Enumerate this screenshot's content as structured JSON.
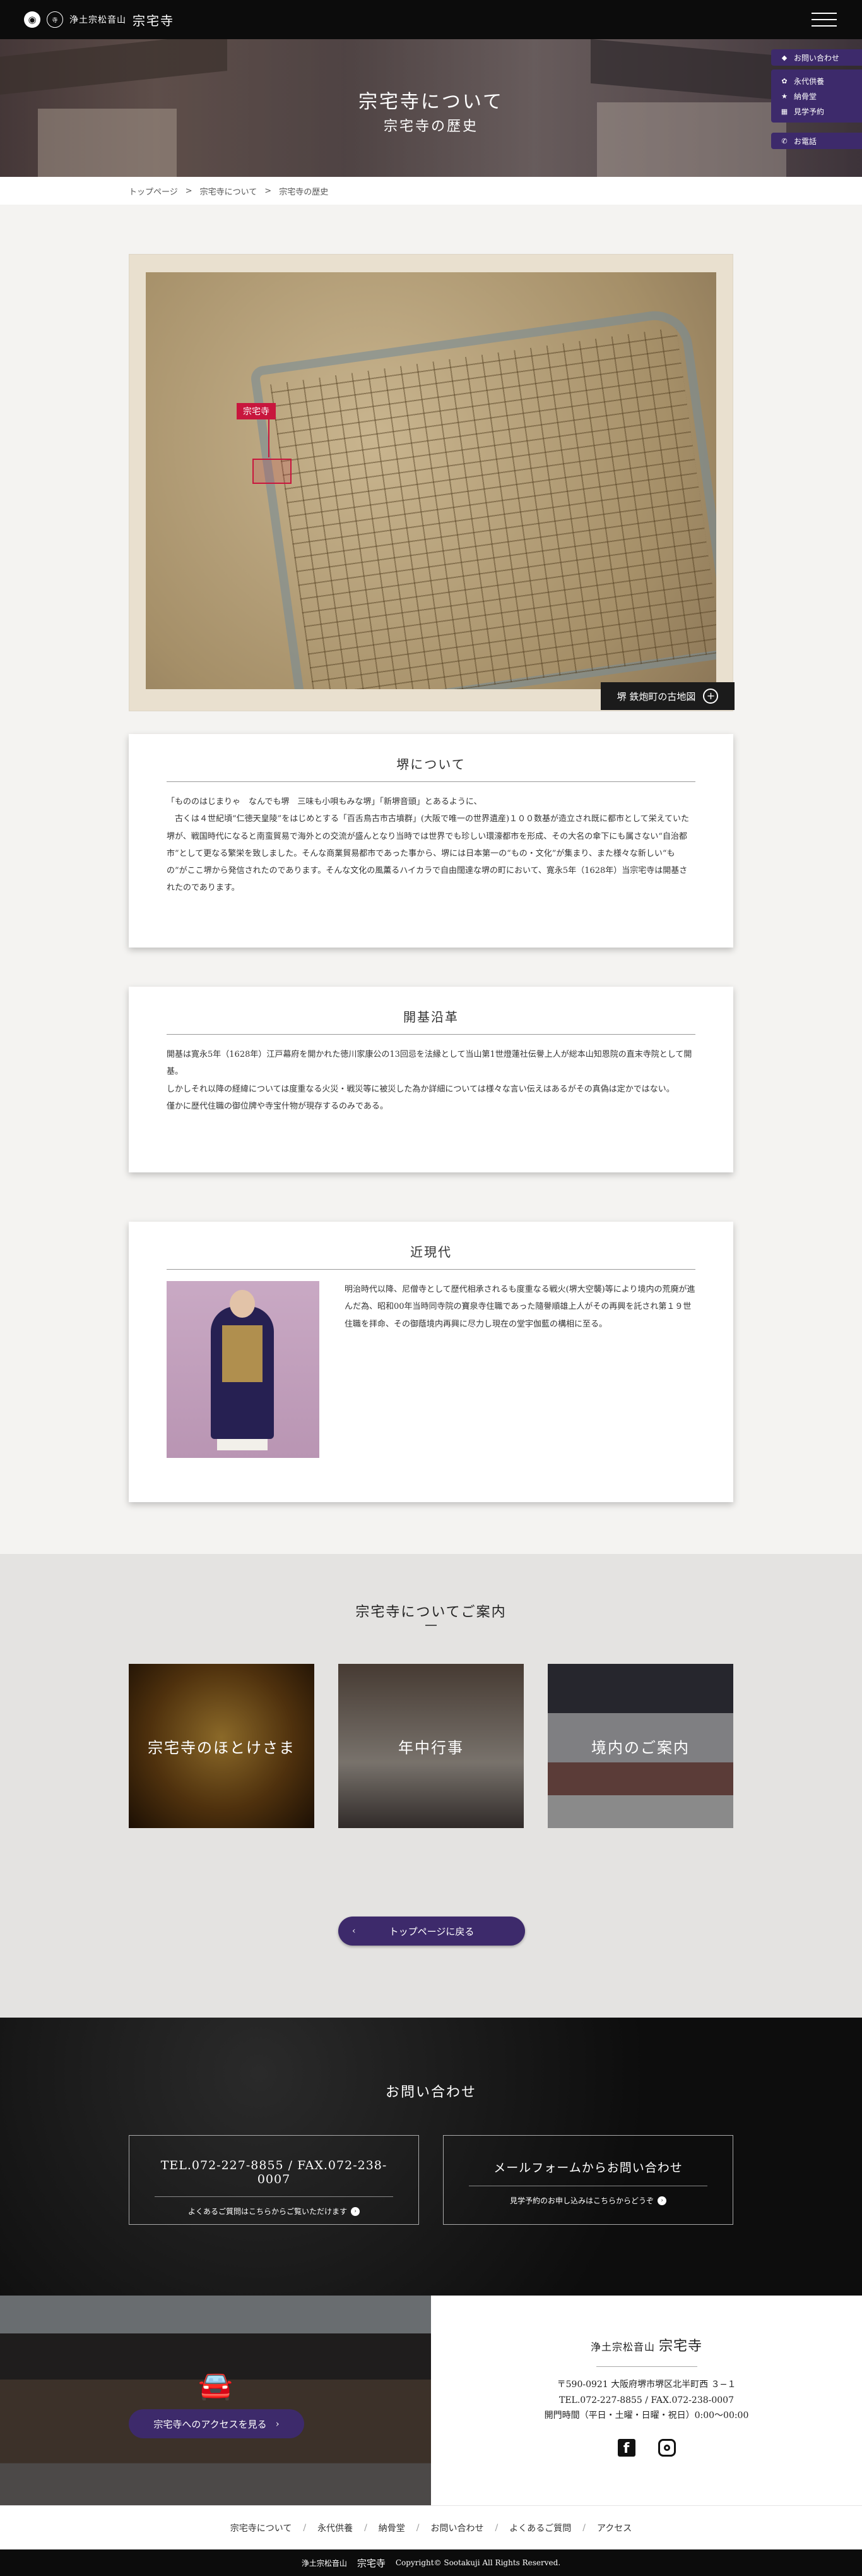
{
  "header": {
    "crest_symbol": "◉",
    "sect_name": "浄土宗松音山",
    "temple_name": "宗宅寺"
  },
  "hero": {
    "title": "宗宅寺について",
    "subtitle": "宗宅寺の歴史"
  },
  "side_menu": {
    "inquiry": "お問い合わせ",
    "links": [
      "永代供養",
      "納骨堂",
      "見学予約"
    ],
    "phone": "お電話"
  },
  "breadcrumb": [
    "トップページ",
    "宗宅寺について",
    "宗宅寺の歴史"
  ],
  "breadcrumb_sep": ">",
  "map": {
    "marker_label": "宗宅寺",
    "caption": "堺 鉄炮町の古地図"
  },
  "sections": {
    "sakai": {
      "title": "堺について",
      "body": "「もののはじまりゃ　なんでも堺　三味も小唄もみな堺」「新堺音頭」とあるように、\n　古くは４世紀頃“仁徳天皇陵”をはじめとする「百舌鳥古市古墳群」(大阪で唯一の世界遺産)１００数基が造立され既に都市として栄えていた堺が、戦国時代になると南蛮貿易で海外との交流が盛んとなり当時では世界でも珍しい環濠都市を形成、その大名の傘下にも属さない“自治都市”として更なる繁栄を致しました。そんな商業貿易都市であった事から、堺には日本第一の“もの・文化”が集まり、また様々な新しい“もの”がここ堺から発信されたのであります。そんな文化の風薫るハイカラで自由闊達な堺の町において、寛永5年（1628年）当宗宅寺は開基されたのであります。"
    },
    "founding": {
      "title": "開基沿革",
      "body": "開基は寛永5年（1628年）江戸幕府を開かれた徳川家康公の13回忌を法縁として当山第1世燈蓮社伝譽上人が総本山知恩院の直末寺院として開基。\nしかしそれ以降の経緯については度重なる火災・戦災等に被災した為か詳細については様々な言い伝えはあるがその真偽は定かではない。\n僅かに歴代住職の御位牌や寺宝什物が現存するのみである。"
    },
    "modern": {
      "title": "近現代",
      "body": "明治時代以降、尼僧寺として歴代相承されるも度重なる戦火(堺大空襲)等により境内の荒廃が進んだ為、昭和00年当時同寺院の寶泉寺住職であった隨譽順雄上人がその再興を託され第１９世住職を拝命、その御蔭境内再興に尽力し現在の堂宇伽藍の構相に至る。"
    }
  },
  "guide": {
    "title": "宗宅寺についてご案内",
    "tiles": [
      "宗宅寺のほとけさま",
      "年中行事",
      "境内のご案内"
    ],
    "back_button": "トップページに戻る"
  },
  "contact": {
    "title": "お問い合わせ",
    "phone": "TEL.072-227-8855 / FAX.072-238-0007",
    "phone_sub": "よくあるご質問はこちらからご覧いただけます",
    "form": "メールフォームからお問い合わせ",
    "form_sub": "見学予約のお申し込みはこちらからどうぞ"
  },
  "access": {
    "button": "宗宅寺へのアクセスを見る",
    "sect": "浄土宗松音山",
    "name": "宗宅寺",
    "address": "〒590-0921 大阪府堺市堺区北半町西 ３−１",
    "tel": "TEL.072-227-8855 / FAX.072-238-0007",
    "hours": "開門時間（平日・土曜・日曜・祝日）0:00〜00:00"
  },
  "footer": {
    "nav": [
      "宗宅寺について",
      "永代供養",
      "納骨堂",
      "お問い合わせ",
      "よくあるご質問",
      "アクセス"
    ],
    "nav_sep": "/",
    "copy_sect": "浄土宗松音山",
    "copy_name": "宗宅寺",
    "copyright": "Copyright© Sootakuji All Rights Reserved."
  },
  "colors": {
    "accent_purple": "#3d2a6b",
    "marker_red": "#c8163d",
    "header_black": "#0c0c0c"
  }
}
